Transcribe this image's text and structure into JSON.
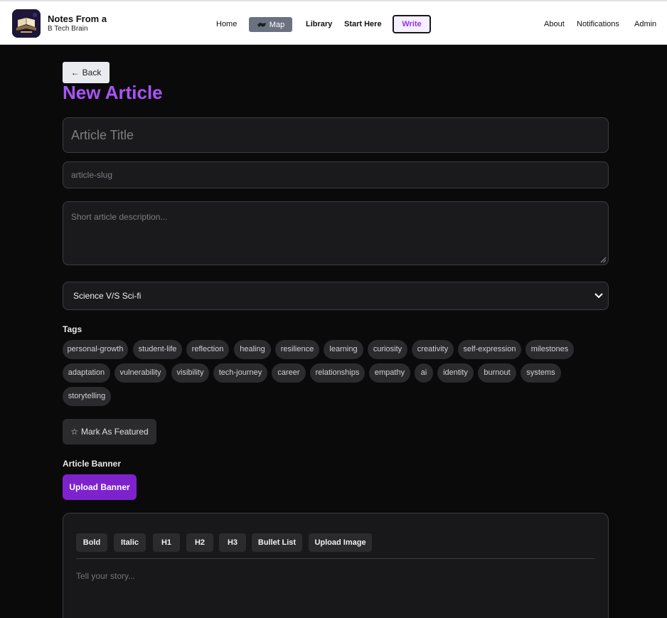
{
  "header": {
    "brand_title": "Notes From a",
    "brand_subtitle": "B Tech Brain",
    "logo_icon": "book-logo-icon",
    "nav": {
      "home": "Home",
      "map": "Map",
      "map_icon": "map-icon",
      "library": "Library",
      "start_here": "Start Here",
      "write": "Write",
      "about": "About",
      "notifications": "Notifications",
      "admin": "Admin"
    }
  },
  "back": {
    "arrow": "←",
    "label": "Back"
  },
  "page_title": "New Article",
  "form": {
    "title_placeholder": "Article Title",
    "slug_placeholder": "article-slug",
    "description_placeholder": "Short article description...",
    "category_selected": "Science V/S Sci-fi",
    "tags_label": "Tags",
    "tags": [
      "personal-growth",
      "student-life",
      "reflection",
      "healing",
      "resilience",
      "learning",
      "curiosity",
      "creativity",
      "self-expression",
      "milestones",
      "adaptation",
      "vulnerability",
      "visibility",
      "tech-journey",
      "career",
      "relationships",
      "empathy",
      "ai",
      "identity",
      "burnout",
      "systems",
      "storytelling"
    ],
    "featured_star": "☆",
    "featured_label": "Mark As Featured",
    "banner_label": "Article Banner",
    "upload_banner_label": "Upload Banner"
  },
  "editor": {
    "toolbar": [
      "Bold",
      "Italic",
      "H1",
      "H2",
      "H3",
      "Bullet List",
      "Upload Image"
    ],
    "placeholder": "Tell your story..."
  },
  "colors": {
    "accent": "#a855f7",
    "upload_button": "#7e22ce",
    "background": "#0a0a0b",
    "panel": "#1a1a1d"
  }
}
